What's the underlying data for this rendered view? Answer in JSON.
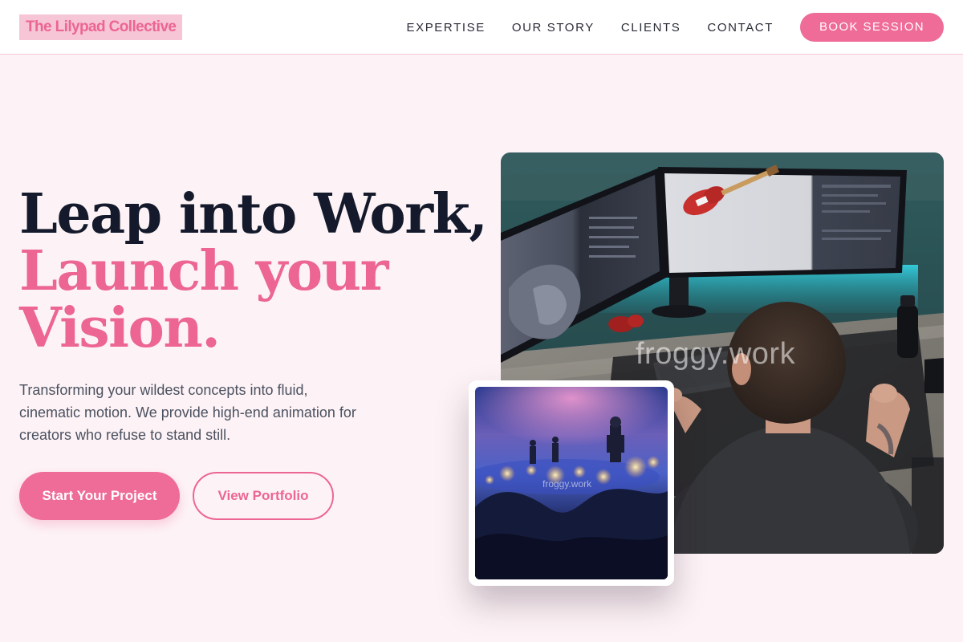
{
  "brand": {
    "name": "The Lilypad Collective"
  },
  "nav": {
    "items": [
      {
        "label": "EXPERTISE"
      },
      {
        "label": "OUR STORY"
      },
      {
        "label": "CLIENTS"
      },
      {
        "label": "CONTACT"
      }
    ],
    "cta_label": "BOOK SESSION"
  },
  "hero": {
    "title_line1": "Leap into Work,",
    "title_line2": "Launch your",
    "title_line3": "Vision.",
    "subtitle": "Transforming your wildest concepts into fluid, cinematic motion. We provide high-end animation for creators who refuse to stand still.",
    "primary_cta": "Start Your Project",
    "secondary_cta": "View Portfolio"
  },
  "media": {
    "main_watermark": "froggy.work",
    "thumb_watermark": "froggy.work"
  },
  "colors": {
    "accent": "#ef6b98",
    "background": "#fdf3f6",
    "heading": "#141a2b",
    "body_text": "#4b5160"
  }
}
